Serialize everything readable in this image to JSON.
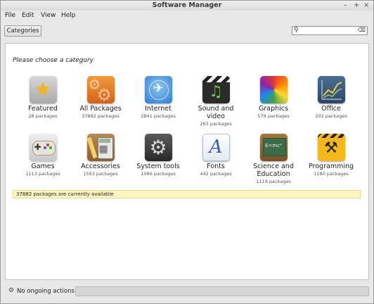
{
  "window": {
    "title": "Software Manager",
    "controls": [
      "–",
      "+",
      "×"
    ]
  },
  "menu": [
    "File",
    "Edit",
    "View",
    "Help"
  ],
  "toolbar": {
    "categories_label": "Categories",
    "search_value": "",
    "search_icon": "magnifier-icon",
    "clear_icon": "clear-icon"
  },
  "main": {
    "prompt": "Please choose a category",
    "categories": [
      {
        "name": "Featured",
        "count": "28 packages",
        "icon": "star-icon"
      },
      {
        "name": "All Packages",
        "count": "37882 packages",
        "icon": "gears-icon"
      },
      {
        "name": "Internet",
        "count": "2841 packages",
        "icon": "globe-icon"
      },
      {
        "name": "Sound and video",
        "count": "263 packages",
        "icon": "clapper-note-icon"
      },
      {
        "name": "Graphics",
        "count": "579 packages",
        "icon": "color-wheel-icon"
      },
      {
        "name": "Office",
        "count": "202 packages",
        "icon": "chart-icon"
      },
      {
        "name": "Games",
        "count": "1113 packages",
        "icon": "gamepad-icon"
      },
      {
        "name": "Accessories",
        "count": "1593 packages",
        "icon": "calculator-icon"
      },
      {
        "name": "System tools",
        "count": "1066 packages",
        "icon": "system-gear-icon"
      },
      {
        "name": "Fonts",
        "count": "442 packages",
        "icon": "font-icon"
      },
      {
        "name": "Science and Education",
        "count": "1119 packages",
        "icon": "chalkboard-icon"
      },
      {
        "name": "Programming",
        "count": "1180 packages",
        "icon": "construction-icon"
      }
    ],
    "icon_glyphs": {
      "star": "★",
      "gears": "⚙",
      "internet": "✈",
      "note": "♫",
      "games": "✚",
      "calc": "▦",
      "system": "⚙",
      "font": "A",
      "emc": "E=mc²",
      "work": "⚒"
    },
    "availability": "37882 packages are currently available"
  },
  "footer": {
    "status": "No ongoing actions",
    "gear_icon": "gear-icon",
    "progress": 0.0
  },
  "colors": {
    "accent": "#8fb0d8",
    "notice_bg": "#fdf6c3"
  }
}
